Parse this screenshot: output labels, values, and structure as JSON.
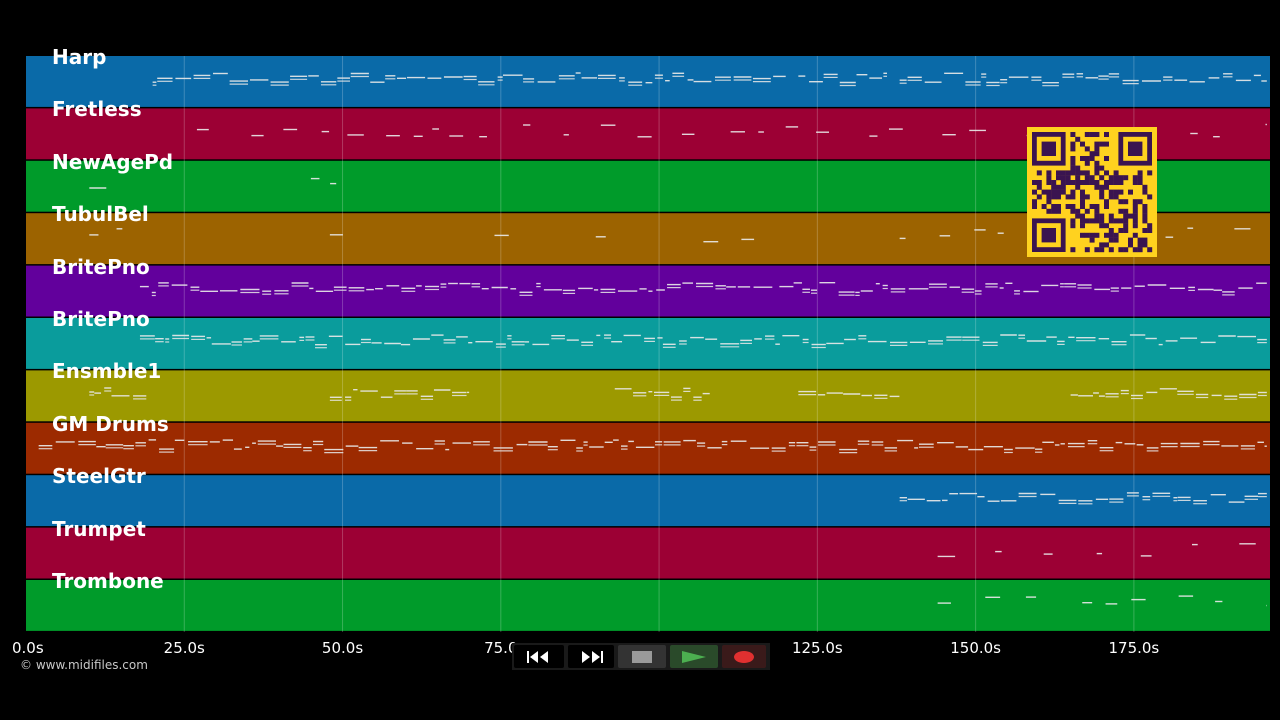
{
  "tracks": [
    {
      "name": "Harp",
      "color": "#0a6aa8"
    },
    {
      "name": "Fretless",
      "color": "#9c0034"
    },
    {
      "name": "NewAgePd",
      "color": "#009b2a"
    },
    {
      "name": "TubulBel",
      "color": "#9c6300"
    },
    {
      "name": "BritePno",
      "color": "#62009c"
    },
    {
      "name": "BritePno",
      "color": "#0a9c9c"
    },
    {
      "name": "Ensmble1",
      "color": "#9c9900"
    },
    {
      "name": "GM Drums",
      "color": "#9c2a00"
    },
    {
      "name": "SteelGtr",
      "color": "#0a6aa8"
    },
    {
      "name": "Trumpet",
      "color": "#9c0034"
    },
    {
      "name": "Trombone",
      "color": "#009b2a"
    }
  ],
  "timeline": {
    "start_s": 0,
    "end_s": 196.5,
    "ticks": [
      {
        "t": 0,
        "label": "0.0s"
      },
      {
        "t": 25,
        "label": "25.0s"
      },
      {
        "t": 50,
        "label": "50.0s"
      },
      {
        "t": 75,
        "label": "75.0"
      },
      {
        "t": 125,
        "label": "125.0s"
      },
      {
        "t": 150,
        "label": "150.0s"
      },
      {
        "t": 175,
        "label": "175.0s"
      }
    ]
  },
  "copyright": "© www.midifiles.com",
  "transport": {
    "rewind_icon": "rewind-icon",
    "forward_icon": "fast-forward-icon",
    "stop_icon": "stop-icon",
    "play_icon": "play-icon",
    "record_icon": "record-icon",
    "play_color": "#4caf50",
    "record_color": "#e03030"
  },
  "qr": {
    "color": "#ffd21f",
    "dark": "#3a1450"
  },
  "note_color": "#e8e8e8"
}
